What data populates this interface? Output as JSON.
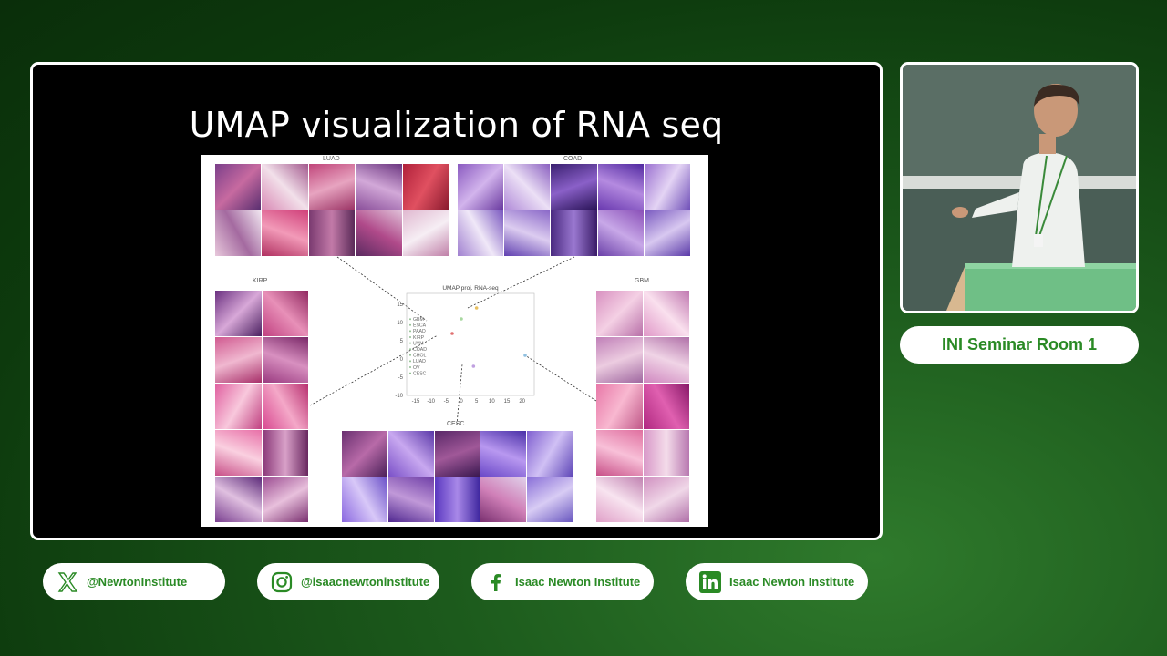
{
  "slide": {
    "title": "UMAP visualization of RNA seq",
    "panels": {
      "luad": "LUAD",
      "coad": "COAD",
      "kirp": "KIRP",
      "gbm": "GBM",
      "cesc": "CESC"
    }
  },
  "chart_data": {
    "type": "scatter",
    "title": "UMAP proj. RNA-seq",
    "xlabel": "",
    "ylabel": "",
    "xlim": [
      -18,
      24
    ],
    "ylim": [
      -10,
      18
    ],
    "xticks": [
      "-15",
      "-10",
      "-5",
      "0",
      "5",
      "10",
      "15",
      "20"
    ],
    "yticks": [
      "15",
      "10",
      "5",
      "0",
      "-5",
      "-10"
    ],
    "legend": [
      "GBM",
      "ESCA",
      "PAAD",
      "KIRP",
      "UVM",
      "COAD",
      "CHOL",
      "LUAD",
      "OV",
      "CESC"
    ],
    "legend_position": "left",
    "series": [
      {
        "name": "LUAD",
        "points": [
          [
            0,
            11
          ]
        ]
      },
      {
        "name": "COAD",
        "points": [
          [
            5,
            14
          ]
        ]
      },
      {
        "name": "KIRP",
        "points": [
          [
            -3,
            7
          ]
        ]
      },
      {
        "name": "GBM",
        "points": [
          [
            21,
            1
          ]
        ]
      },
      {
        "name": "CESC",
        "points": [
          [
            4,
            -2
          ]
        ]
      }
    ],
    "colors": {
      "LUAD": "#a8d8a0",
      "COAD": "#e8c060",
      "KIRP": "#e07070",
      "GBM": "#90c0e0",
      "CESC": "#c0a0e0"
    }
  },
  "webcam": {
    "description": ""
  },
  "room": {
    "label": "INI Seminar Room 1"
  },
  "socials": [
    {
      "icon": "x-logo-icon",
      "label": "@NewtonInstitute"
    },
    {
      "icon": "instagram-icon",
      "label": "@isaacnewtoninstitute"
    },
    {
      "icon": "facebook-icon",
      "label": "Isaac Newton Institute"
    },
    {
      "icon": "linkedin-icon",
      "label": "Isaac Newton Institute"
    }
  ],
  "colors": {
    "brand_green": "#2a8a25",
    "background_green": "#1c5a1c"
  }
}
